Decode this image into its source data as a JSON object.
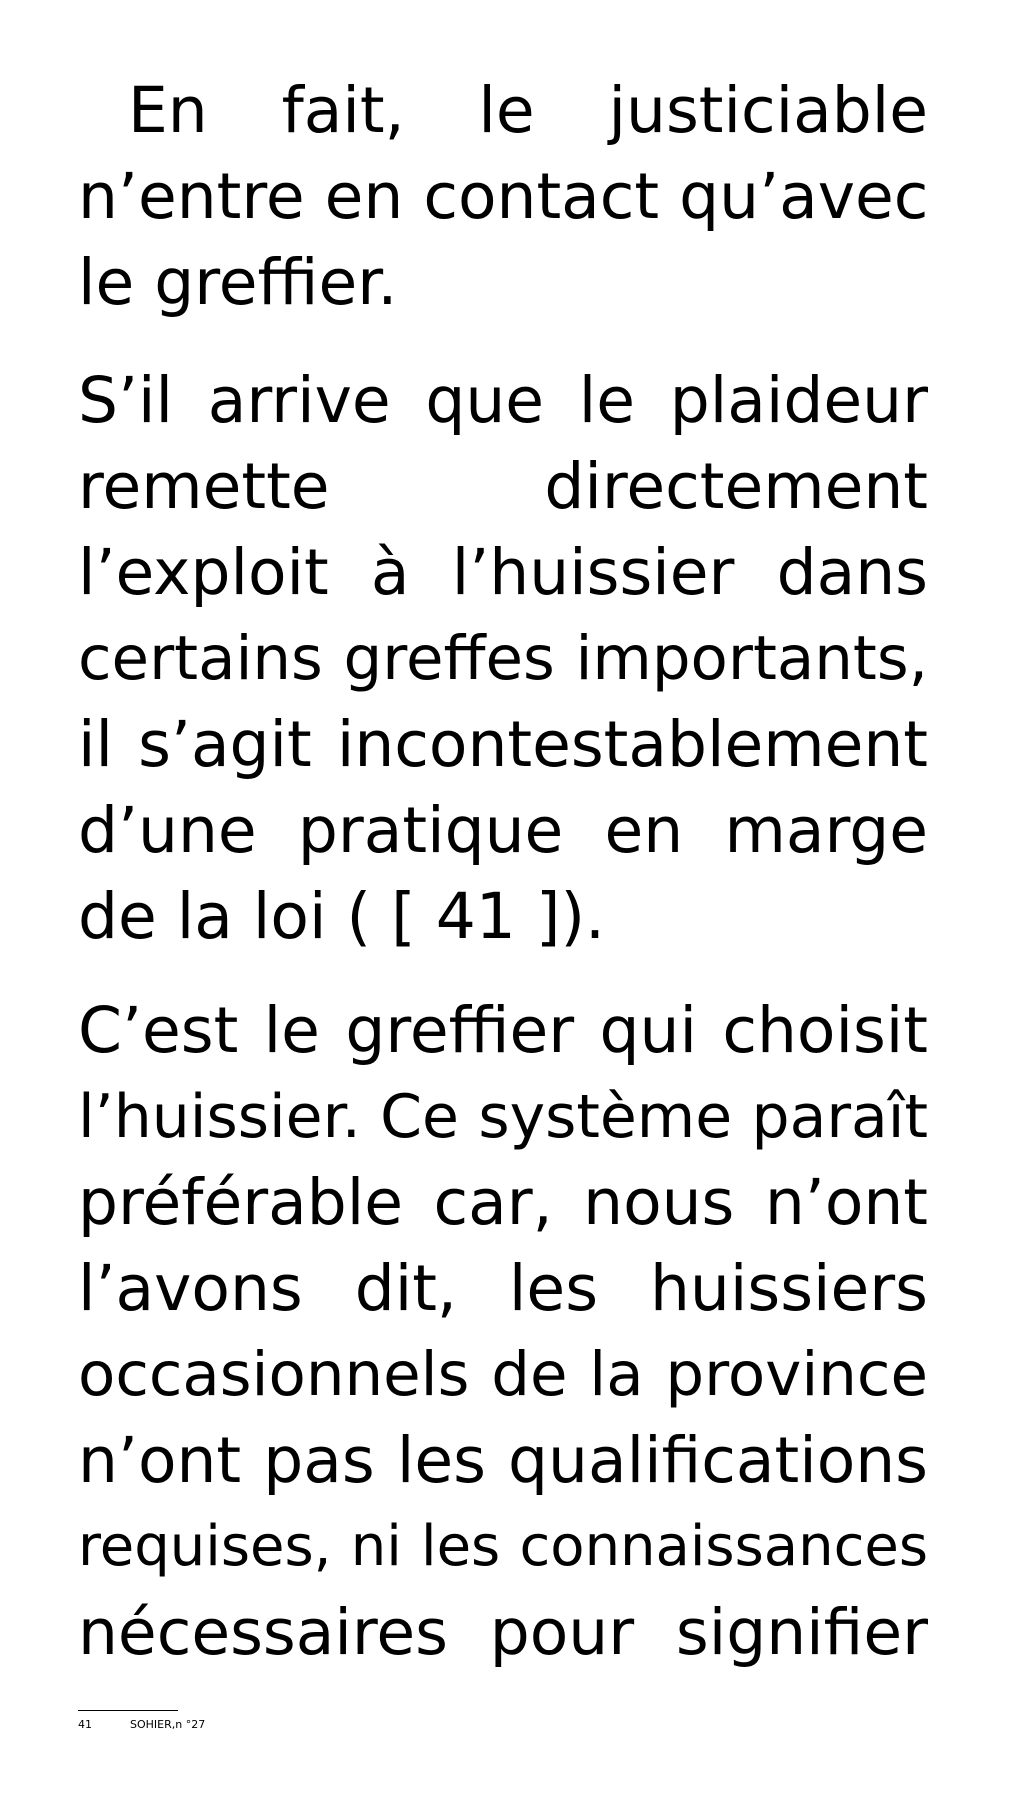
{
  "paragraphs": [
    {
      "lines": [
        "En fait, le justiciable",
        "n’entre en contact qu’avec",
        "le greffier."
      ]
    },
    {
      "lines": [
        "S’il arrive que le plaideur",
        "remette directement",
        "l’exploit à l’huissier dans",
        "certains greffes importants,",
        "il s’agit incontestablement",
        "d’une pratique en marge",
        "de la loi ( [ 41 ])."
      ]
    },
    {
      "lines": [
        "C’est le greffier qui choisit",
        "l’huissier. Ce système paraît",
        "préférable car, nous n’ont",
        "l’avons dit, les huissiers",
        "occasionnels de la province",
        "n’ont pas les qualifications",
        "requises, ni les connaissances",
        "nécessaires pour signifier"
      ]
    }
  ],
  "footnote": {
    "number": "41",
    "text": "SOHIER,n °27"
  }
}
